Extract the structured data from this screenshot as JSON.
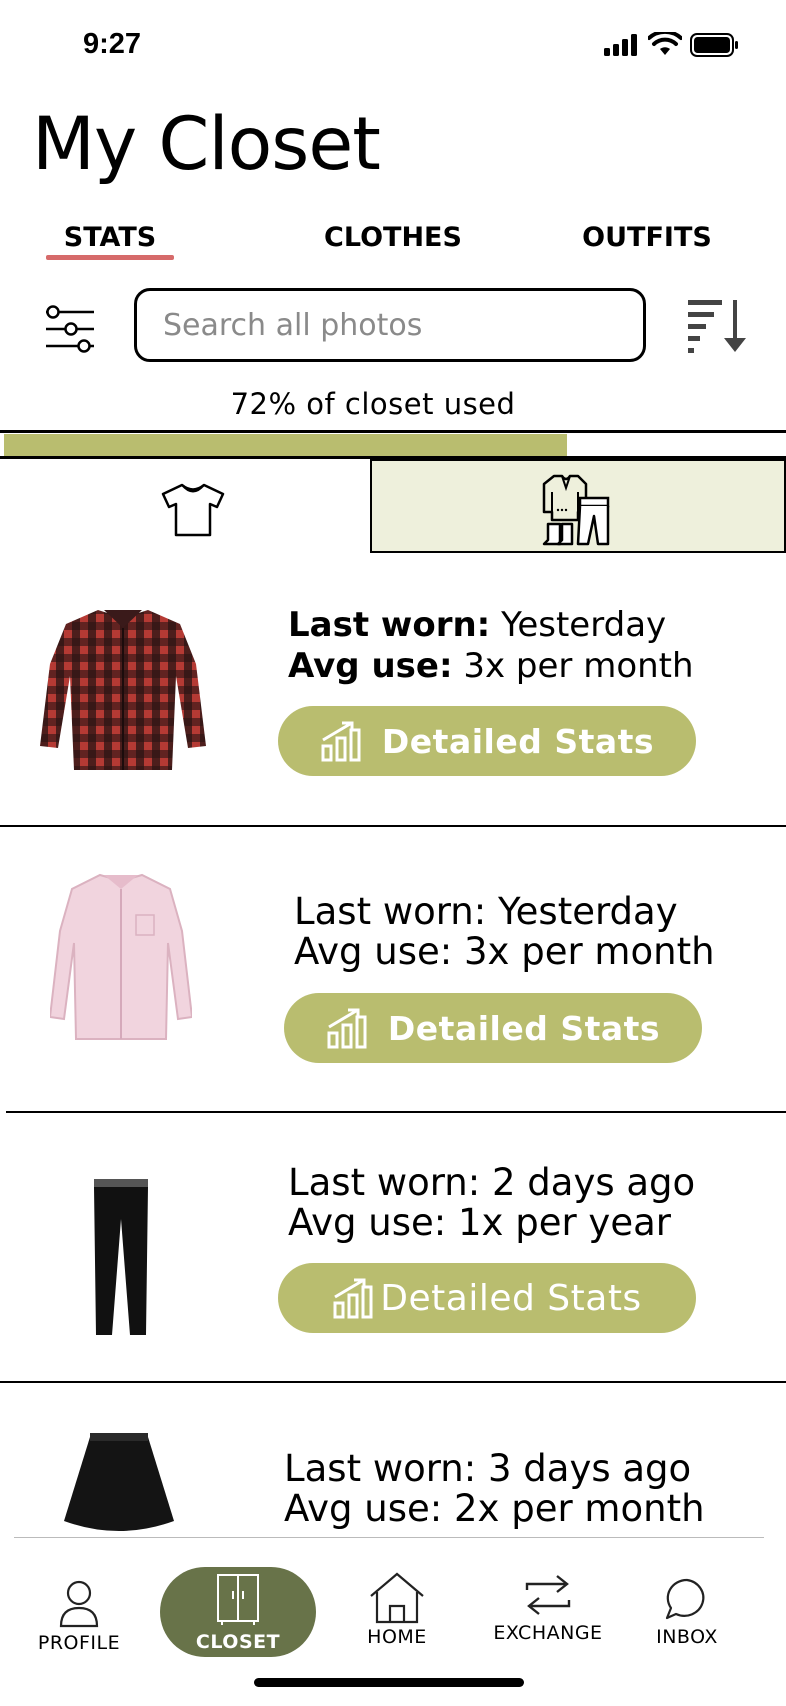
{
  "status_bar": {
    "time": "9:27"
  },
  "page": {
    "title": "My Closet"
  },
  "tabs": [
    {
      "label": "STATS",
      "active": true
    },
    {
      "label": "CLOTHES",
      "active": false
    },
    {
      "label": "OUTFITS",
      "active": false
    }
  ],
  "search": {
    "placeholder": "Search all photos"
  },
  "usage": {
    "label": "72% of closet used",
    "fraction": 0.72,
    "color": "#b9bd6f"
  },
  "view_toggle": {
    "selected": "outfits"
  },
  "items": [
    {
      "image": "red-flannel-shirt",
      "last_worn_label": "Last worn:",
      "last_worn_value": "Yesterday",
      "avg_use_label": "Avg use:",
      "avg_use_value": "3x per month",
      "button_label": "Detailed Stats"
    },
    {
      "image": "pink-dress-shirt",
      "last_worn_label": "Last worn:",
      "last_worn_value": "Yesterday",
      "avg_use_label": "Avg use:",
      "avg_use_value": "3x per month",
      "button_label": "Detailed Stats"
    },
    {
      "image": "black-pants",
      "last_worn_label": "Last worn:",
      "last_worn_value": "2 days ago",
      "avg_use_label": "Avg use:",
      "avg_use_value": "1x per year",
      "button_label": "Detailed Stats"
    },
    {
      "image": "black-skirt",
      "last_worn_label": "Last worn:",
      "last_worn_value": "3 days ago",
      "avg_use_label": "Avg use:",
      "avg_use_value": "2x per month"
    }
  ],
  "nav": [
    {
      "label": "PROFILE",
      "icon": "person-icon",
      "active": false
    },
    {
      "label": "CLOSET",
      "icon": "wardrobe-icon",
      "active": true
    },
    {
      "label": "HOME",
      "icon": "house-icon",
      "active": false
    },
    {
      "label": "EXCHANGE",
      "icon": "exchange-icon",
      "active": false
    },
    {
      "label": "INBOX",
      "icon": "chat-bubble-icon",
      "active": false
    }
  ],
  "colors": {
    "accent": "#b9bd6f",
    "tab_underline": "#d66a6a",
    "nav_active": "#687349",
    "outfit_tab_bg": "#eef0dc"
  }
}
